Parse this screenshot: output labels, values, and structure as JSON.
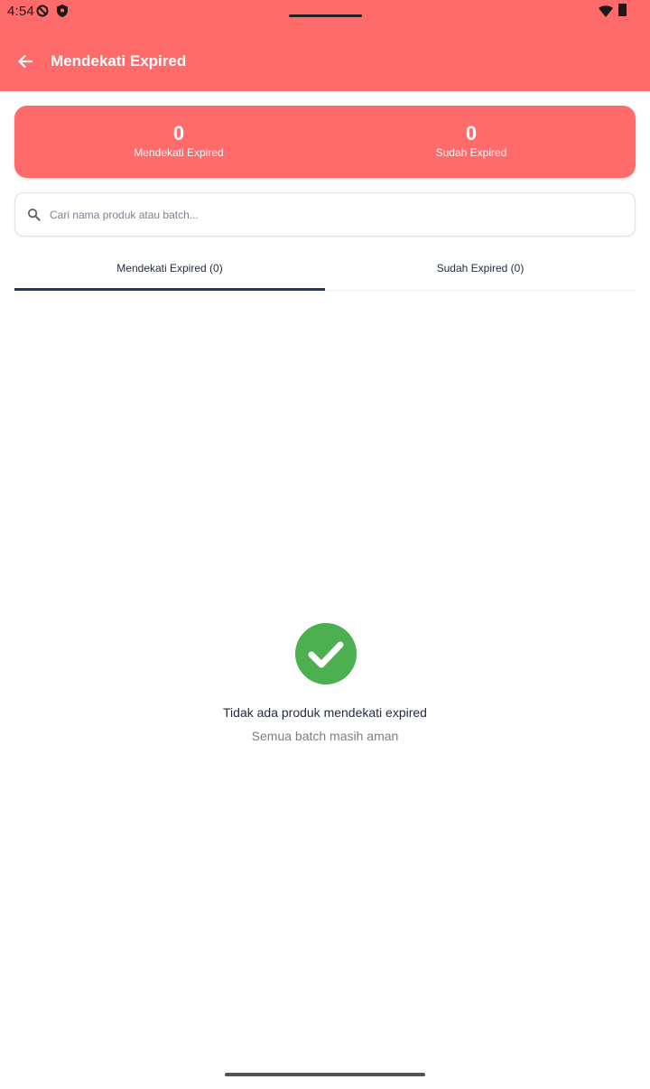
{
  "status_bar": {
    "time": "4:54"
  },
  "appbar": {
    "title": "Mendekati Expired"
  },
  "summary": {
    "near_expired": {
      "value": "0",
      "label": "Mendekati Expired"
    },
    "expired": {
      "value": "0",
      "label": "Sudah Expired"
    }
  },
  "search": {
    "placeholder": "Cari nama produk atau batch...",
    "value": ""
  },
  "tabs": [
    {
      "label": "Mendekati Expired (0)",
      "selected": true
    },
    {
      "label": "Sudah Expired (0)",
      "selected": false
    }
  ],
  "empty_state": {
    "icon": "check-circle-icon",
    "title": "Tidak ada produk mendekati expired",
    "subtitle": "Semua batch masih aman"
  },
  "colors": {
    "accent": "#ff6b6b",
    "tab_indicator": "#1f3a5f",
    "success": "#4caf50"
  }
}
